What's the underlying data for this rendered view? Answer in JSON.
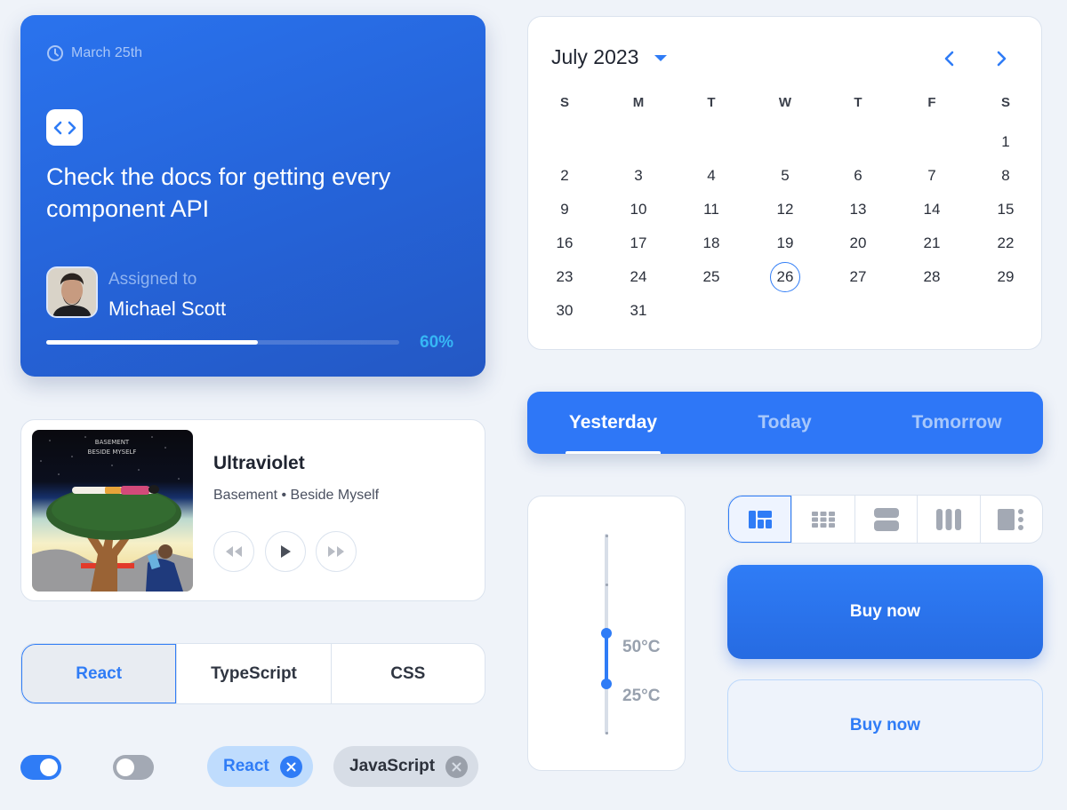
{
  "task_card": {
    "date_icon": "clock-icon",
    "date": "March 25th",
    "badge_icon": "code-icon",
    "title": "Check the docs for getting every component API",
    "assigned_label": "Assigned to",
    "assignee": "Michael Scott",
    "progress_percent": 60,
    "progress_label": "60%",
    "accent_color": "#2a73ee",
    "progress_label_color": "#36b6f5"
  },
  "calendar": {
    "month_label": "July 2023",
    "dropdown_icon": "caret-down-icon",
    "prev_icon": "chevron-left-icon",
    "next_icon": "chevron-right-icon",
    "weekdays": [
      "S",
      "M",
      "T",
      "W",
      "T",
      "F",
      "S"
    ],
    "weeks": [
      [
        "",
        "",
        "",
        "",
        "",
        "",
        "1"
      ],
      [
        "2",
        "3",
        "4",
        "5",
        "6",
        "7",
        "8"
      ],
      [
        "9",
        "10",
        "11",
        "12",
        "13",
        "14",
        "15"
      ],
      [
        "16",
        "17",
        "18",
        "19",
        "20",
        "21",
        "22"
      ],
      [
        "23",
        "24",
        "25",
        "26",
        "27",
        "28",
        "29"
      ],
      [
        "30",
        "31",
        "",
        "",
        "",
        "",
        ""
      ]
    ],
    "selected_day": "26",
    "accent_color": "#2f7cf6"
  },
  "music": {
    "title": "Ultraviolet",
    "meta": "Basement • Beside Myself",
    "album_text_line1": "BASEMENT",
    "album_text_line2": "BESIDE MYSELF",
    "controls": [
      "rewind-icon",
      "play-icon",
      "fast-forward-icon"
    ]
  },
  "segmented": {
    "items": [
      "React",
      "TypeScript",
      "CSS"
    ],
    "active_index": 0
  },
  "toggles": [
    {
      "state": "on",
      "color": "#2f7cf6"
    },
    {
      "state": "off",
      "color": "#a3a9b4"
    }
  ],
  "chips": [
    {
      "label": "React",
      "variant": "primary",
      "close_icon": "close-icon"
    },
    {
      "label": "JavaScript",
      "variant": "neutral",
      "close_icon": "close-icon"
    }
  ],
  "tabs": {
    "items": [
      "Yesterday",
      "Today",
      "Tomorrow"
    ],
    "active_index": 0,
    "background": "#2e77f7"
  },
  "range_slider": {
    "upper_label": "50°C",
    "lower_label": "25°C",
    "upper_value": 50,
    "lower_value": 25
  },
  "view_switcher": {
    "items": [
      "dashboard-layout-icon",
      "grid-icon",
      "rows-icon",
      "columns-icon",
      "sidebar-layout-icon"
    ],
    "active_index": 0
  },
  "buttons": {
    "primary_label": "Buy now",
    "outline_label": "Buy now"
  }
}
